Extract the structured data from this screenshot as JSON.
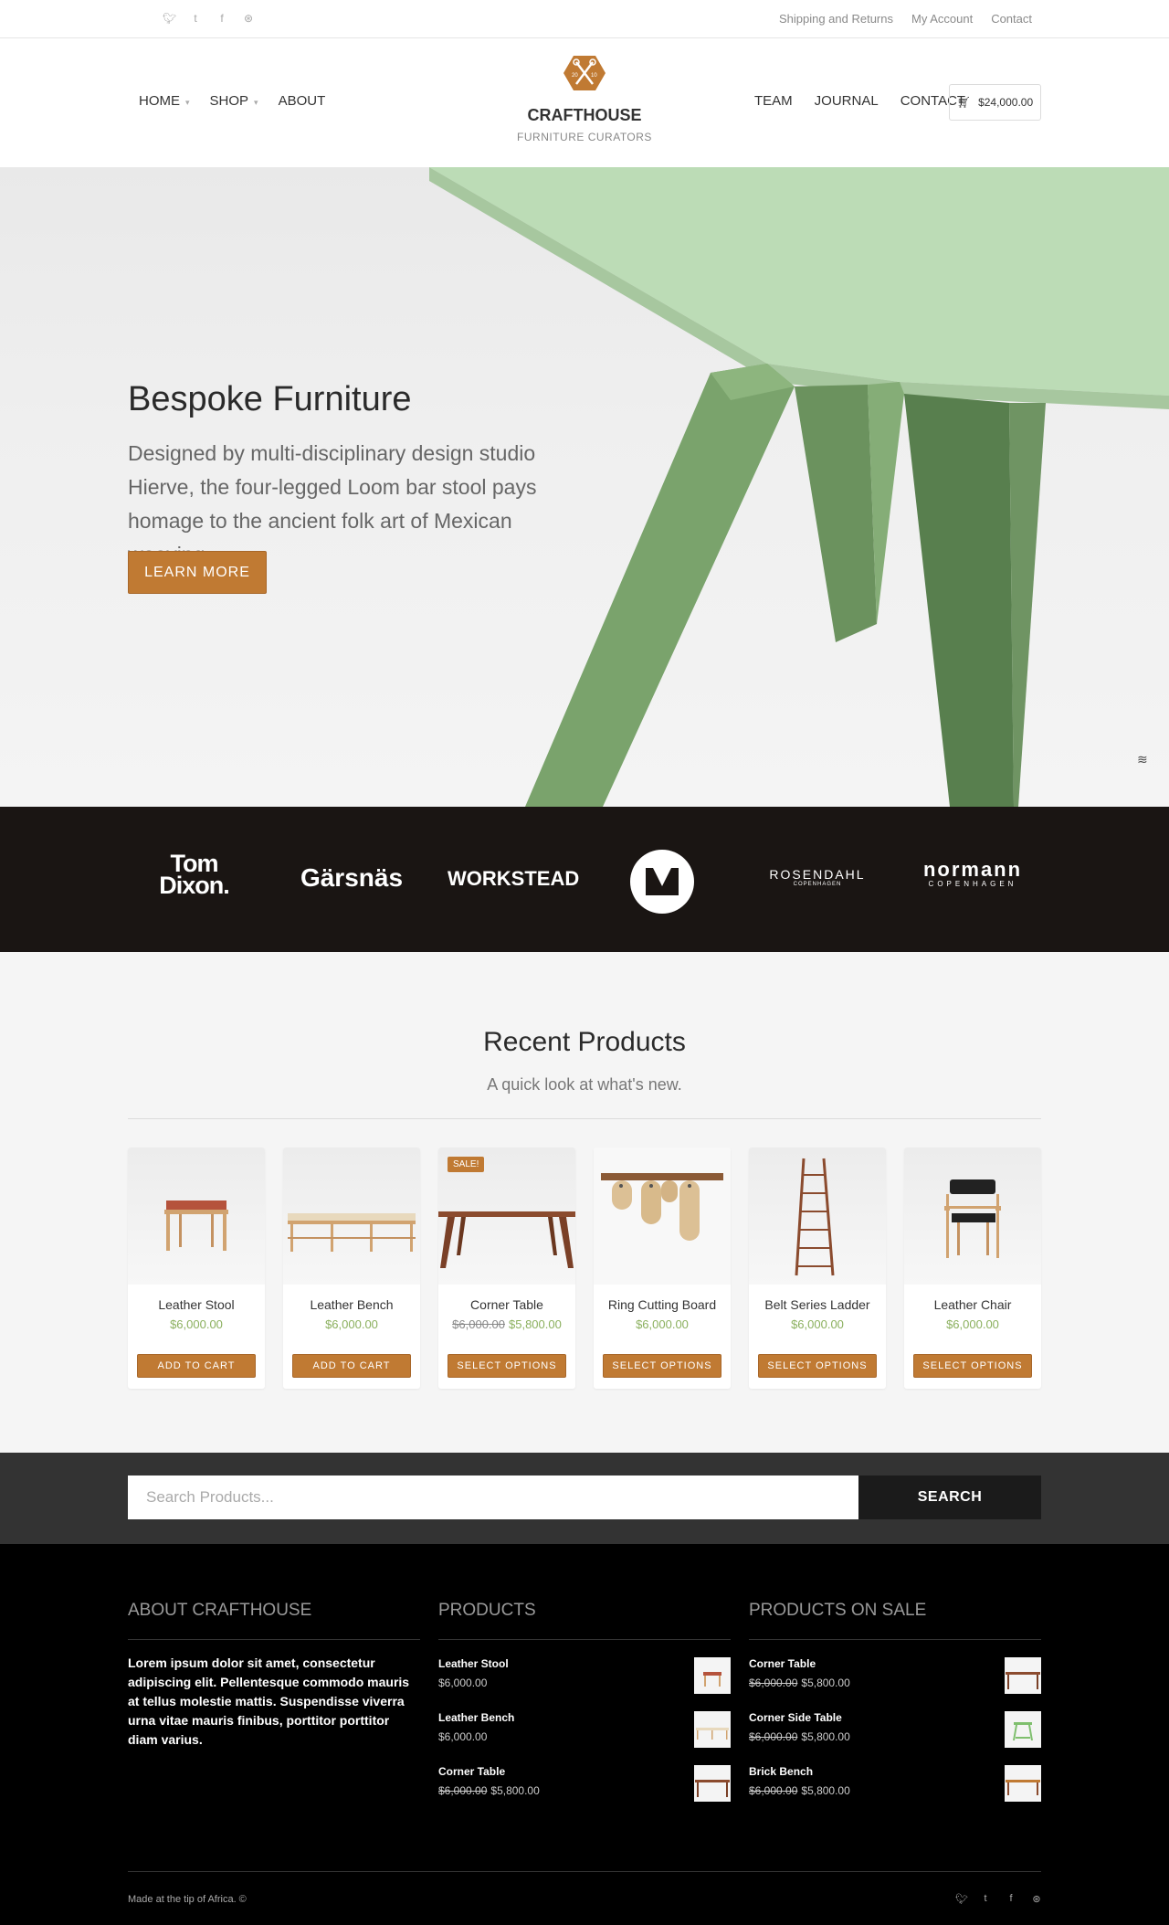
{
  "topbar": {
    "social_icons": [
      "apple-icon",
      "twitter-icon",
      "tumblr-icon",
      "facebook-icon",
      "dribbble-icon"
    ],
    "links": [
      "Shipping and Returns",
      "My Account",
      "Contact"
    ]
  },
  "header": {
    "logo_badge_text": "20 10",
    "logo_title": "CRAFTHOUSE",
    "logo_subtitle": "FURNITURE CURATORS",
    "nav_left": [
      {
        "label": "HOME",
        "has_dropdown": true
      },
      {
        "label": "SHOP",
        "has_dropdown": true
      },
      {
        "label": "ABOUT",
        "has_dropdown": false
      }
    ],
    "nav_right": [
      {
        "label": "TEAM"
      },
      {
        "label": "JOURNAL"
      },
      {
        "label": "CONTACT"
      }
    ],
    "cart_total": "$24,000.00"
  },
  "hero": {
    "title": "Bespoke Furniture",
    "text": "Designed by multi-disciplinary design studio Hierve, the four-legged Loom bar stool pays homage to the ancient folk art of Mexican weaving.",
    "button_label": "LEARN MORE"
  },
  "brands": [
    {
      "name": "Tom Dixon."
    },
    {
      "name": "Gärsnäs"
    },
    {
      "name": "WORKSTEAD"
    },
    {
      "name": "Herman Miller logo"
    },
    {
      "name": "ROSENDAHL",
      "sub": "COPENHAGEN"
    },
    {
      "name": "normann",
      "sub": "COPENHAGEN"
    }
  ],
  "recent": {
    "title": "Recent Products",
    "subtitle": "A quick look at what's new.",
    "sale_badge": "SALE!",
    "products": [
      {
        "name": "Leather Stool",
        "price": "$6,000.00",
        "old_price": "",
        "button": "ADD TO CART"
      },
      {
        "name": "Leather Bench",
        "price": "$6,000.00",
        "old_price": "",
        "button": "ADD TO CART"
      },
      {
        "name": "Corner Table",
        "price": "$5,800.00",
        "old_price": "$6,000.00",
        "button": "SELECT OPTIONS",
        "on_sale": true
      },
      {
        "name": "Ring Cutting Board",
        "price": "$6,000.00",
        "old_price": "",
        "button": "SELECT OPTIONS"
      },
      {
        "name": "Belt Series Ladder",
        "price": "$6,000.00",
        "old_price": "",
        "button": "SELECT OPTIONS"
      },
      {
        "name": "Leather Chair",
        "price": "$6,000.00",
        "old_price": "",
        "button": "SELECT OPTIONS"
      }
    ]
  },
  "search": {
    "placeholder": "Search Products...",
    "button_label": "SEARCH"
  },
  "footer": {
    "about_title": "ABOUT CRAFTHOUSE",
    "about_text": "Lorem ipsum dolor sit amet, consectetur adipiscing elit. Pellentesque commodo mauris at tellus molestie mattis. Suspendisse viverra urna vitae mauris finibus, porttitor porttitor diam varius.",
    "products_title": "PRODUCTS",
    "products": [
      {
        "name": "Leather Stool",
        "price": "$6,000.00",
        "old_price": ""
      },
      {
        "name": "Leather Bench",
        "price": "$6,000.00",
        "old_price": ""
      },
      {
        "name": "Corner Table",
        "price": "$5,800.00",
        "old_price": "$6,000.00"
      }
    ],
    "sale_title": "PRODUCTS ON SALE",
    "sale_products": [
      {
        "name": "Corner Table",
        "price": "$5,800.00",
        "old_price": "$6,000.00"
      },
      {
        "name": "Corner Side Table",
        "price": "$5,800.00",
        "old_price": "$6,000.00"
      },
      {
        "name": "Brick Bench",
        "price": "$5,800.00",
        "old_price": "$6,000.00"
      }
    ],
    "copyright": "Made at the tip of Africa. ©",
    "social_icons": [
      "apple-icon",
      "twitter-icon",
      "tumblr-icon",
      "facebook-icon",
      "dribbble-icon"
    ]
  },
  "colors": {
    "accent": "#c07a33",
    "price_green": "#8bb05e",
    "brand_strip": "#1a1513",
    "footer_bg": "#000000",
    "search_band": "#333333"
  }
}
